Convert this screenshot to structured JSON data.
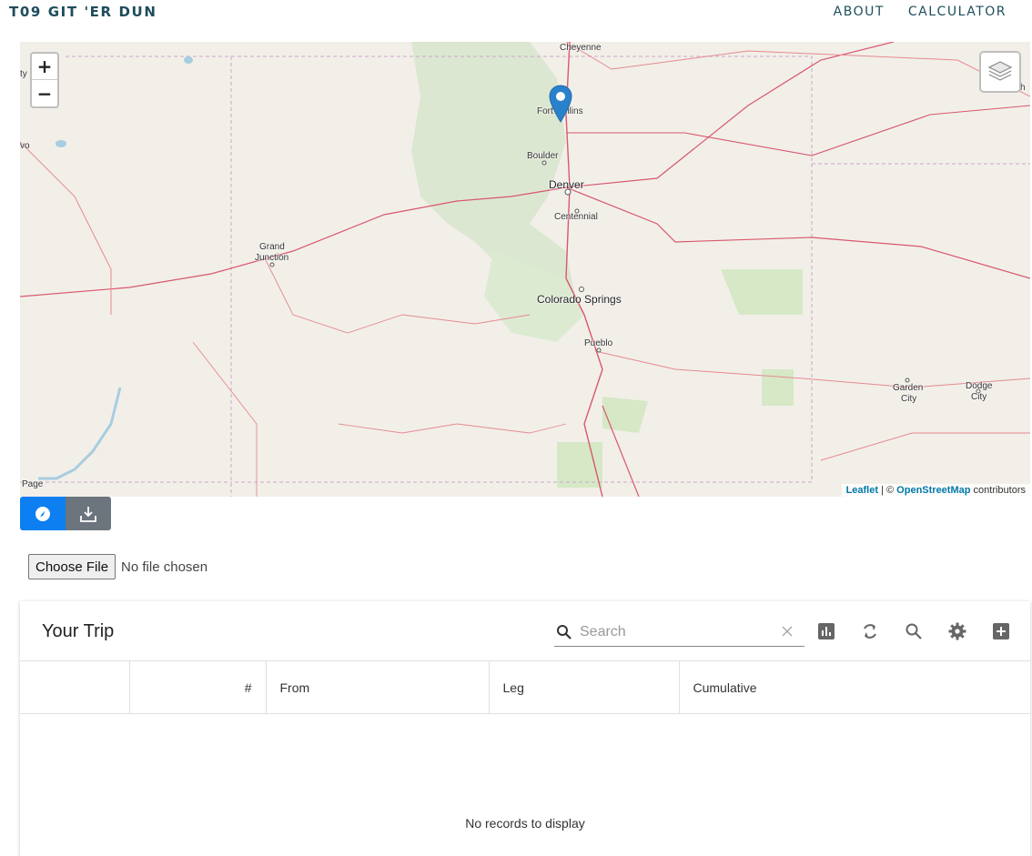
{
  "header": {
    "brand": "T09 GIT 'ER DUN",
    "nav": [
      {
        "label": "ABOUT"
      },
      {
        "label": "CALCULATOR"
      }
    ]
  },
  "map": {
    "zoom_in": "+",
    "zoom_out": "−",
    "labels": {
      "cheyenne": "Cheyenne",
      "fort_collins": "Fort Collins",
      "boulder": "Boulder",
      "denver": "Denver",
      "centennial": "Centennial",
      "grand_junction_1": "Grand",
      "grand_junction_2": "Junction",
      "colorado_springs": "Colorado Springs",
      "pueblo": "Pueblo",
      "garden_city_1": "Garden",
      "garden_city_2": "City",
      "dodge_city_1": "Dodge",
      "dodge_city_2": "City",
      "page": "Page",
      "edge_ty": "ty",
      "edge_vo": "vo",
      "edge_h": "h"
    },
    "attribution": {
      "leaflet": "Leaflet",
      "sep": " | © ",
      "osm": "OpenStreetMap",
      "contributors": " contributors"
    },
    "marker_icon": "map-marker-icon",
    "accent_color": "#0d7ff0"
  },
  "map_buttons": {
    "locate_icon": "location-compass-icon",
    "download_icon": "download-icon"
  },
  "file_input": {
    "button_label": "Choose File",
    "status": "No file chosen"
  },
  "trip": {
    "title": "Your Trip",
    "search_placeholder": "Search",
    "search_value": "",
    "toolbar_icons": [
      "chart-icon",
      "refresh-icon",
      "search-icon",
      "settings-icon",
      "add-icon"
    ],
    "columns": [
      "",
      "#",
      "From",
      "Leg",
      "Cumulative"
    ],
    "rows": [],
    "empty_message": "No records to display"
  }
}
